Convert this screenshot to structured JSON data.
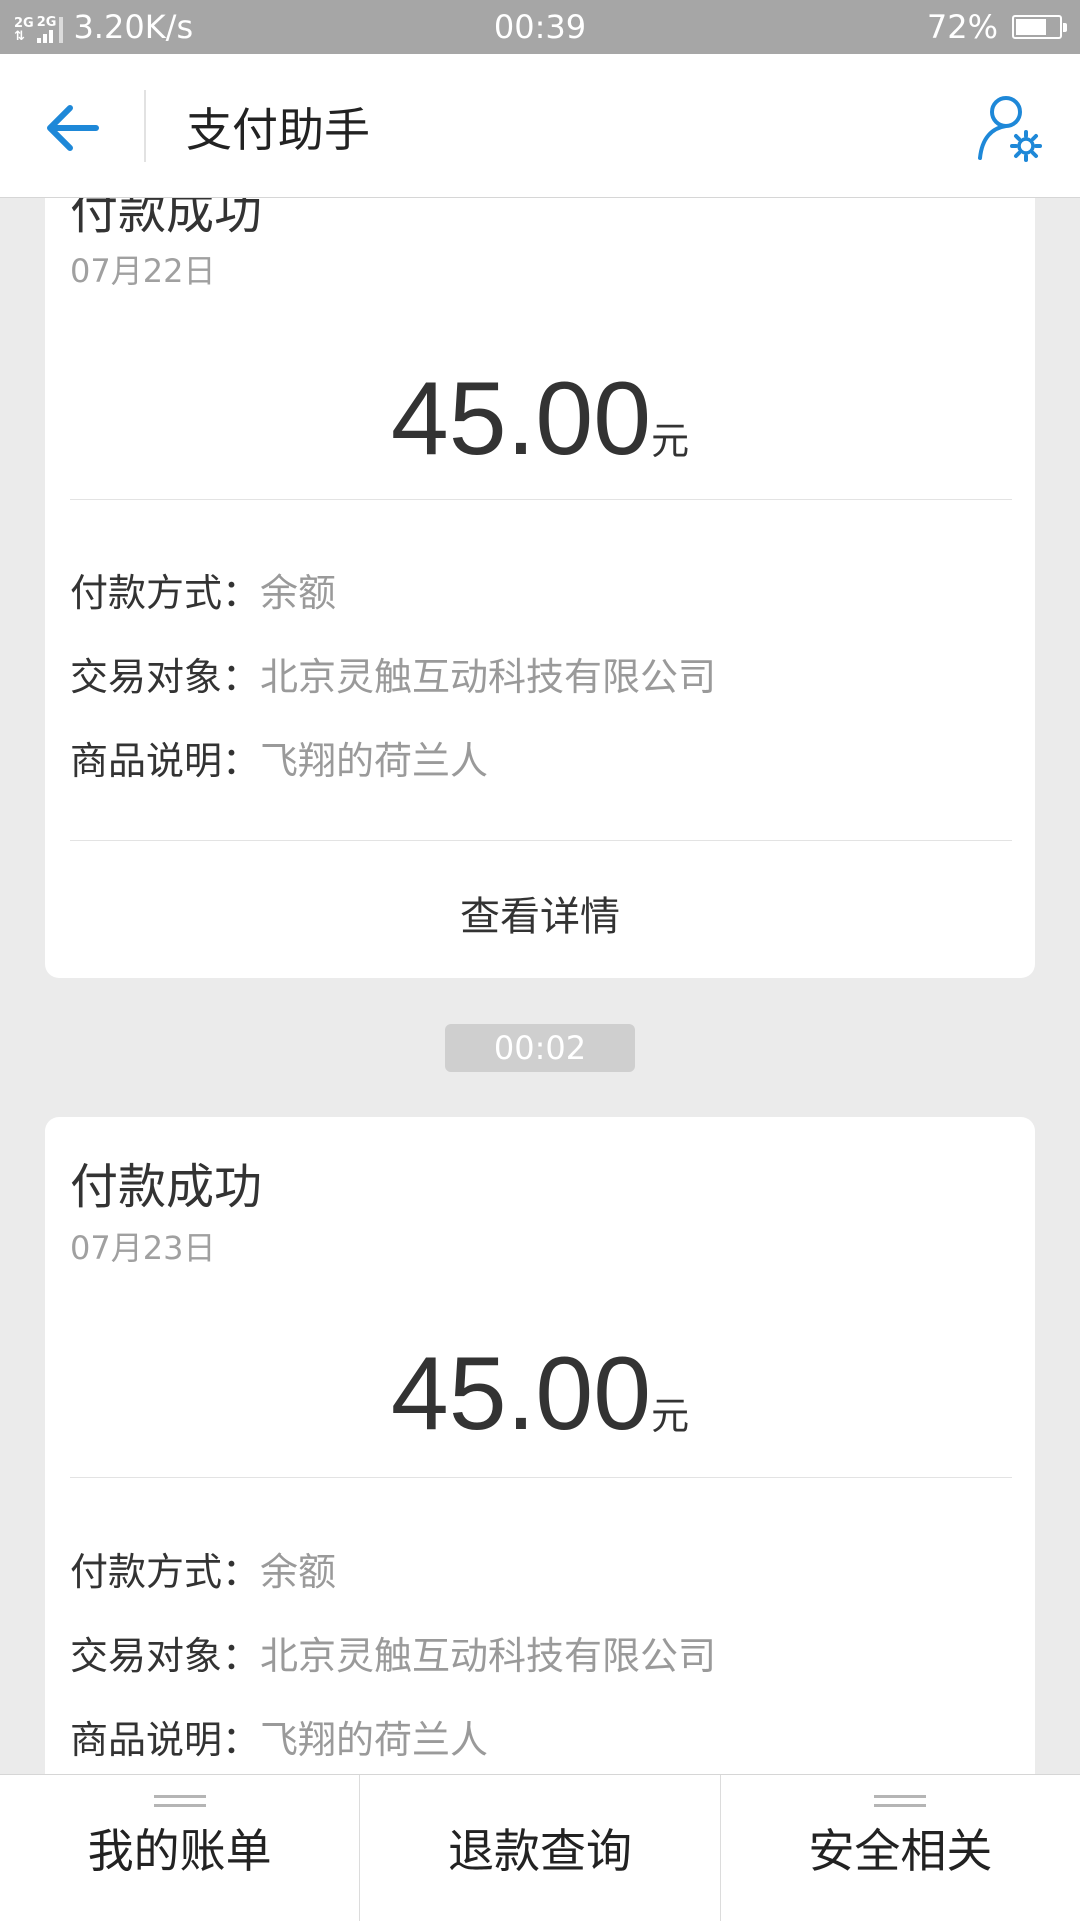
{
  "status_bar": {
    "network_type_1": "2G",
    "network_type_2": "2G",
    "speed": "3.20K/s",
    "time": "00:39",
    "battery": "72%",
    "battery_level": 0.72
  },
  "header": {
    "title": "支付助手",
    "back_icon": "arrow-left-icon",
    "settings_icon": "user-settings-icon",
    "accent_color": "#1e88d8"
  },
  "cards": [
    {
      "title": "付款成功",
      "date": "07月22日",
      "amount": "45.00",
      "unit": "元",
      "rows": [
        {
          "label": "付款方式：",
          "value": "余额"
        },
        {
          "label": "交易对象：",
          "value": "北京灵触互动科技有限公司"
        },
        {
          "label": "商品说明：",
          "value": "飞翔的荷兰人"
        }
      ],
      "details": "查看详情"
    },
    {
      "title": "付款成功",
      "date": "07月23日",
      "amount": "45.00",
      "unit": "元",
      "rows": [
        {
          "label": "付款方式：",
          "value": "余额"
        },
        {
          "label": "交易对象：",
          "value": "北京灵触互动科技有限公司"
        },
        {
          "label": "商品说明：",
          "value": "飞翔的荷兰人"
        }
      ]
    }
  ],
  "time_separator": "00:02",
  "bottom_bar": {
    "tabs": [
      {
        "label": "我的账单",
        "has_menu": true
      },
      {
        "label": "退款查询",
        "has_menu": false
      },
      {
        "label": "安全相关",
        "has_menu": true
      }
    ]
  }
}
